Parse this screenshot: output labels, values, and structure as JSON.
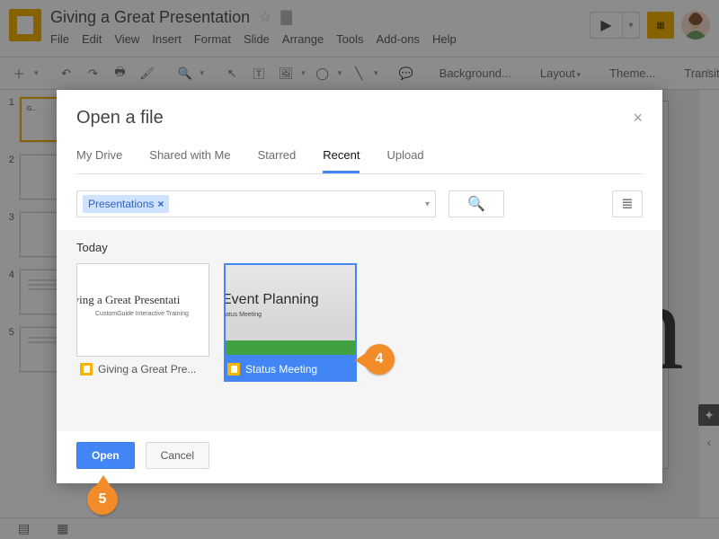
{
  "header": {
    "doc_title": "Giving a Great Presentation",
    "menus": [
      "File",
      "Edit",
      "View",
      "Insert",
      "Format",
      "Slide",
      "Arrange",
      "Tools",
      "Add-ons",
      "Help"
    ]
  },
  "toolbar": {
    "background": "Background...",
    "layout": "Layout",
    "theme": "Theme...",
    "transition": "Transition..."
  },
  "filmstrip": {
    "slides": [
      {
        "num": "1",
        "mini": "G..."
      },
      {
        "num": "2",
        "mini": ""
      },
      {
        "num": "3",
        "mini": ""
      },
      {
        "num": "4",
        "mini": ""
      },
      {
        "num": "5",
        "mini": ""
      }
    ]
  },
  "canvas": {
    "big_char": "n"
  },
  "dialog": {
    "title": "Open a file",
    "tabs": [
      "My Drive",
      "Shared with Me",
      "Starred",
      "Recent",
      "Upload"
    ],
    "active_tab": "Recent",
    "filter_chip": "Presentations",
    "section": "Today",
    "files": [
      {
        "label": "Giving a Great Pre...",
        "thumb_title": "iving a Great Presentati",
        "thumb_sub": "CustomGuide Interactive Training",
        "selected": false
      },
      {
        "label": "Status Meeting",
        "thumb_title": "Event Planning",
        "thumb_sub": "atus Meeting",
        "selected": true
      }
    ],
    "actions": {
      "open": "Open",
      "cancel": "Cancel"
    }
  },
  "callouts": {
    "c4": "4",
    "c5": "5"
  }
}
